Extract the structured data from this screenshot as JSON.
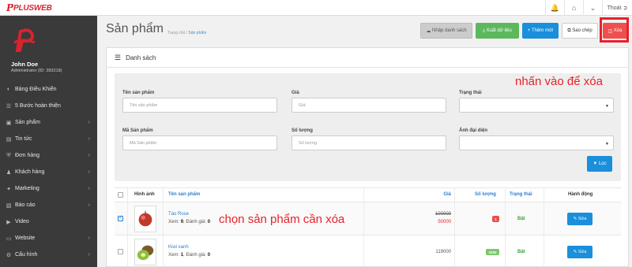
{
  "topbar": {
    "logo_mark": "P",
    "logo_text": "PLUSWEB",
    "icons": [
      "bell-icon",
      "home-icon",
      "chevron-down-icon"
    ],
    "logout_label": "Thoát"
  },
  "sidebar": {
    "user_name": "John Doe",
    "user_role": "Administrator (ID: 283218)",
    "items": [
      {
        "label": "Bảng Điều Khiển",
        "icon": "dashboard-icon",
        "submenu": false
      },
      {
        "label": "5 Bước hoàn thiện",
        "icon": "list-icon",
        "submenu": false
      },
      {
        "label": "Sản phẩm",
        "icon": "cube-icon",
        "submenu": true
      },
      {
        "label": "Tin tức",
        "icon": "newspaper-icon",
        "submenu": true
      },
      {
        "label": "Đơn hàng",
        "icon": "cart-icon",
        "submenu": true
      },
      {
        "label": "Khách hàng",
        "icon": "users-icon",
        "submenu": true
      },
      {
        "label": "Marketing",
        "icon": "share-icon",
        "submenu": true
      },
      {
        "label": "Báo cáo",
        "icon": "chart-icon",
        "submenu": true
      },
      {
        "label": "Video",
        "icon": "video-icon",
        "submenu": false
      },
      {
        "label": "Website",
        "icon": "monitor-icon",
        "submenu": true
      },
      {
        "label": "Cấu hình",
        "icon": "gear-icon",
        "submenu": true
      }
    ]
  },
  "header": {
    "title": "Sản phẩm",
    "breadcrumb_home": "Trang chủ",
    "breadcrumb_sep": "/",
    "breadcrumb_current": "Sản phẩm"
  },
  "toolbar": {
    "import_label": "Nhập danh sách",
    "export_label": "Xuất dữ liệu",
    "add_label": "Thêm mới",
    "copy_label": "Sao chép",
    "delete_label": "Xóa"
  },
  "panel": {
    "title": "Danh sách"
  },
  "filter": {
    "name_label": "Tên sản phẩm",
    "name_placeholder": "Tên sản phẩm",
    "price_label": "Giá",
    "price_placeholder": "Giá",
    "status_label": "Trạng thái",
    "status_value": "",
    "code_label": "Mã Sản phẩm",
    "code_placeholder": "Mã Sản phẩm",
    "qty_label": "Số lượng",
    "qty_placeholder": "Số lượng",
    "image_label": "Ảnh đại diện",
    "image_value": "",
    "filter_button": "Lọc"
  },
  "annotations": {
    "delete_hint": "nhấn vào để xóa",
    "select_hint": "chọn sản phẩm cần xóa"
  },
  "table": {
    "columns": [
      "Hình ảnh",
      "Tên sản phẩm",
      "Giá",
      "Số lượng",
      "Trạng thái",
      "Hành động"
    ],
    "rows": [
      {
        "checked": true,
        "name": "Táo Rose",
        "views_label": "Xem:",
        "views": "9",
        "rating_label": "Đánh giá:",
        "rating": "0",
        "price_old": "100000",
        "price_new": "50000",
        "qty": "1",
        "qty_color": "#e85050",
        "status": "Bật",
        "action": "Sửa",
        "thumb": "apple-image"
      },
      {
        "checked": false,
        "name": "Kiwi xanh",
        "views_label": "Xem:",
        "views": "1",
        "rating_label": "Đánh giá:",
        "rating": "0",
        "price": "119000",
        "qty": "1000",
        "qty_color": "#7cc66e",
        "status": "Bật",
        "action": "Sửa",
        "thumb": "kiwi-image"
      }
    ]
  },
  "colors": {
    "accent": "#1a8fdb",
    "danger": "#e8212a",
    "success": "#5cb85c",
    "sidebar": "#3a3a3a"
  }
}
